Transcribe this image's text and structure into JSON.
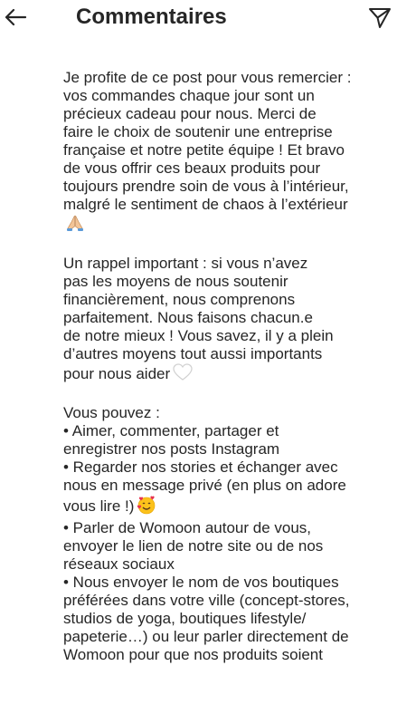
{
  "header": {
    "back_icon": "arrow-left-icon",
    "title": "Commentaires",
    "send_icon": "direct-send-icon"
  },
  "comment": {
    "paragraphs": [
      {
        "lines": [
          "Je profite de ce post pour vous remercier :",
          "vos commandes chaque jour sont un",
          "précieux cadeau pour nous. Merci de",
          "faire le choix de soutenir une entreprise",
          "française et notre petite équipe ! Et bravo",
          "de vous offrir ces beaux produits pour",
          "toujours prendre soin de vous à l’intérieur,",
          "malgré le sentiment de chaos à l’extérieur",
          ""
        ],
        "emoji_after_line": 8,
        "emoji": "folded-hands-emoji"
      },
      {
        "lines": [
          "Un rappel important : si vous n’avez",
          "pas les moyens de nous soutenir",
          "financièrement, nous comprenons",
          "parfaitement. Nous faisons chacun.e",
          "de notre mieux ! Vous savez, il y a plein",
          "d’autres moyens tout aussi importants",
          "pour nous aider"
        ],
        "emoji_after_line": 6,
        "emoji": "white-heart-emoji"
      },
      {
        "lines": [
          "Vous pouvez :",
          "• Aimer, commenter, partager et",
          "enregistrer nos posts Instagram",
          "• Regarder nos stories et échanger avec",
          "nous en message privé (en plus on adore",
          "vous lire !)",
          "• Parler de Womoon autour de vous,",
          "envoyer le lien de notre site ou de nos",
          "réseaux sociaux",
          "• Nous envoyer le nom de vos boutiques",
          "préférées dans votre ville (concept-stores,",
          "studios de yoga, boutiques lifestyle/",
          "papeterie…) ou leur parler directement de",
          "Womoon pour que nos produits soient"
        ],
        "emoji_after_line": 5,
        "emoji": "smiling-face-with-hearts-emoji"
      }
    ]
  }
}
